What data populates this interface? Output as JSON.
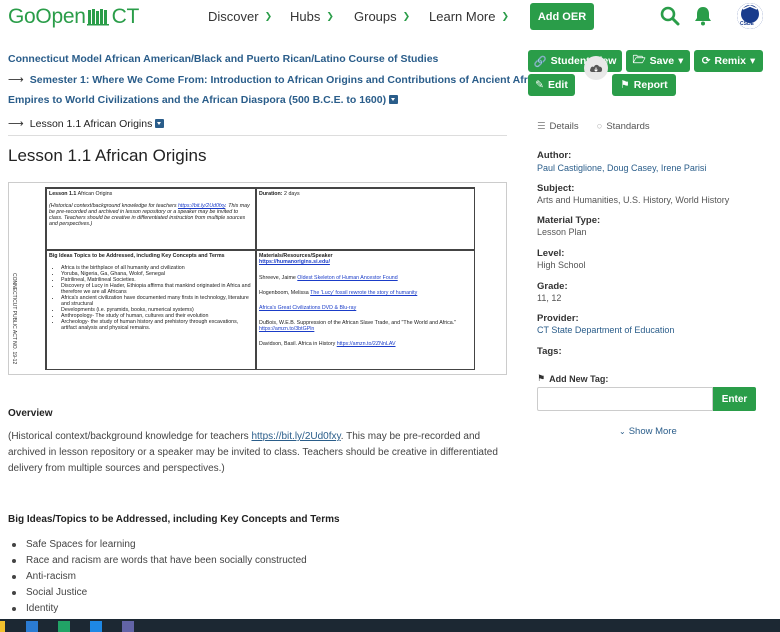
{
  "nav": {
    "logo_prefix": "GoOpen",
    "logo_suffix": "CT",
    "items": [
      "Discover",
      "Hubs",
      "Groups",
      "Learn More"
    ],
    "add_oer": "Add OER"
  },
  "breadcrumb": {
    "course": "Connecticut Model African American/Black and Puerto Rican/Latino Course of Studies",
    "semester_line1": "Semester 1: Where We Come From: Introduction to African Origins and Contributions of Ancient African",
    "semester_line2": "Empires to World Civilizations and the African Diaspora (500 B.C.E. to 1600)",
    "lesson": "Lesson 1.1 African Origins"
  },
  "lesson_title": "Lesson 1.1 African Origins",
  "preview": {
    "cell1_title": "Lesson 1.1",
    "cell1_title_rest": " African Origins",
    "duration_label": "Duration:",
    "duration_value": "2 days",
    "context_line": "(Historical context/background knowledge for teachers",
    "context_link": "https://bit.ly/2Ud0fxy",
    "context_rest": ".  This may be pre-recorded and archived in lesson repository or a speaker may be invited to class.  Teachers should be creative in differentiated instruction from multiple sources and perspectives.)",
    "big_ideas_head": "Big Ideas Topics to be Addressed, including Key Concepts and Terms",
    "big_ideas": [
      "Africa is the birthplace of all humanity and civilization",
      "Yoruba, Nigeria, Ga, Ghana, Wolof, Senegal",
      "Patrilineal, Matrilineal Societies.",
      "Discovery of Lucy in Hader, Ethiopia affirms that mankind originated in Africa and therefore we are all Africans",
      "Africa's ancient civilization have documented many firsts in technology, literature and structural",
      "Developments (i.e. pyramids, books, numerical systems)",
      "Anthropology- The study of human, cultures and their evolution",
      "Archeology- the study of human history and prehistory through excavations, artifact analysis and physical remains."
    ],
    "materials_head": "Materials/Resources/Speaker",
    "materials_link": "https://humanorigins.si.edu/",
    "materials": [
      {
        "text": "Shreeve, Jaime ",
        "link": "Oldest Skeleton of Human Ancestor Found"
      },
      {
        "text": "Hogenboom, Melissa ",
        "link": "The 'Lucy' fossil rewrote the story of humanity"
      },
      {
        "text": "",
        "link": "Africa's Great Civilizations DVD & Blu-ray"
      },
      {
        "text": "DuBois, W.E.B. Suppression of the African Slave Trade, and \"The World and Africa.\" ",
        "link": "https://amzn.to/3btGPln"
      },
      {
        "text": "Davidson, Basil. Africa in History ",
        "link": "https://amzn.to/2ZNnLAV"
      }
    ],
    "side_text": "CONNECTICUT PUBLIC ACT NO. 19-12"
  },
  "overview": {
    "heading": "Overview",
    "text_before": "(Historical context/background knowledge for teachers ",
    "link": "https://bit.ly/2Ud0fxy",
    "text_after": ".  This may be pre-recorded and archived in lesson repository or a speaker may be invited to class.  Teachers should be creative in differentiated delivery from multiple sources and perspectives.)"
  },
  "big_ideas": {
    "heading": "Big Ideas/Topics to be Addressed, including Key Concepts and Terms",
    "items": [
      "Safe Spaces for learning",
      "Race and racism are words that have been socially constructed",
      "Anti-racism",
      "Social Justice",
      "Identity"
    ]
  },
  "actions": {
    "student_view": "Student View",
    "save": "Save",
    "remix": "Remix",
    "edit": "Edit",
    "report": "Report"
  },
  "tabs": [
    "Details",
    "Standards"
  ],
  "meta": {
    "author_label": "Author:",
    "author_value": "Paul Castiglione, Doug Casey, Irene Parisi",
    "subject_label": "Subject:",
    "subject_value": "Arts and Humanities, U.S. History, World History",
    "material_label": "Material Type:",
    "material_value": "Lesson Plan",
    "level_label": "Level:",
    "level_value": "High School",
    "grade_label": "Grade:",
    "grade_value": "11, 12",
    "provider_label": "Provider:",
    "provider_value": "CT State Department of Education",
    "tags_label": "Tags:",
    "add_tag_label": "Add New Tag:",
    "tag_input_value": "",
    "enter": "Enter",
    "show_more": "Show More"
  },
  "avatar_text": "CSDE",
  "colors": {
    "accent": "#2a9d49",
    "link": "#2a5d8a"
  }
}
